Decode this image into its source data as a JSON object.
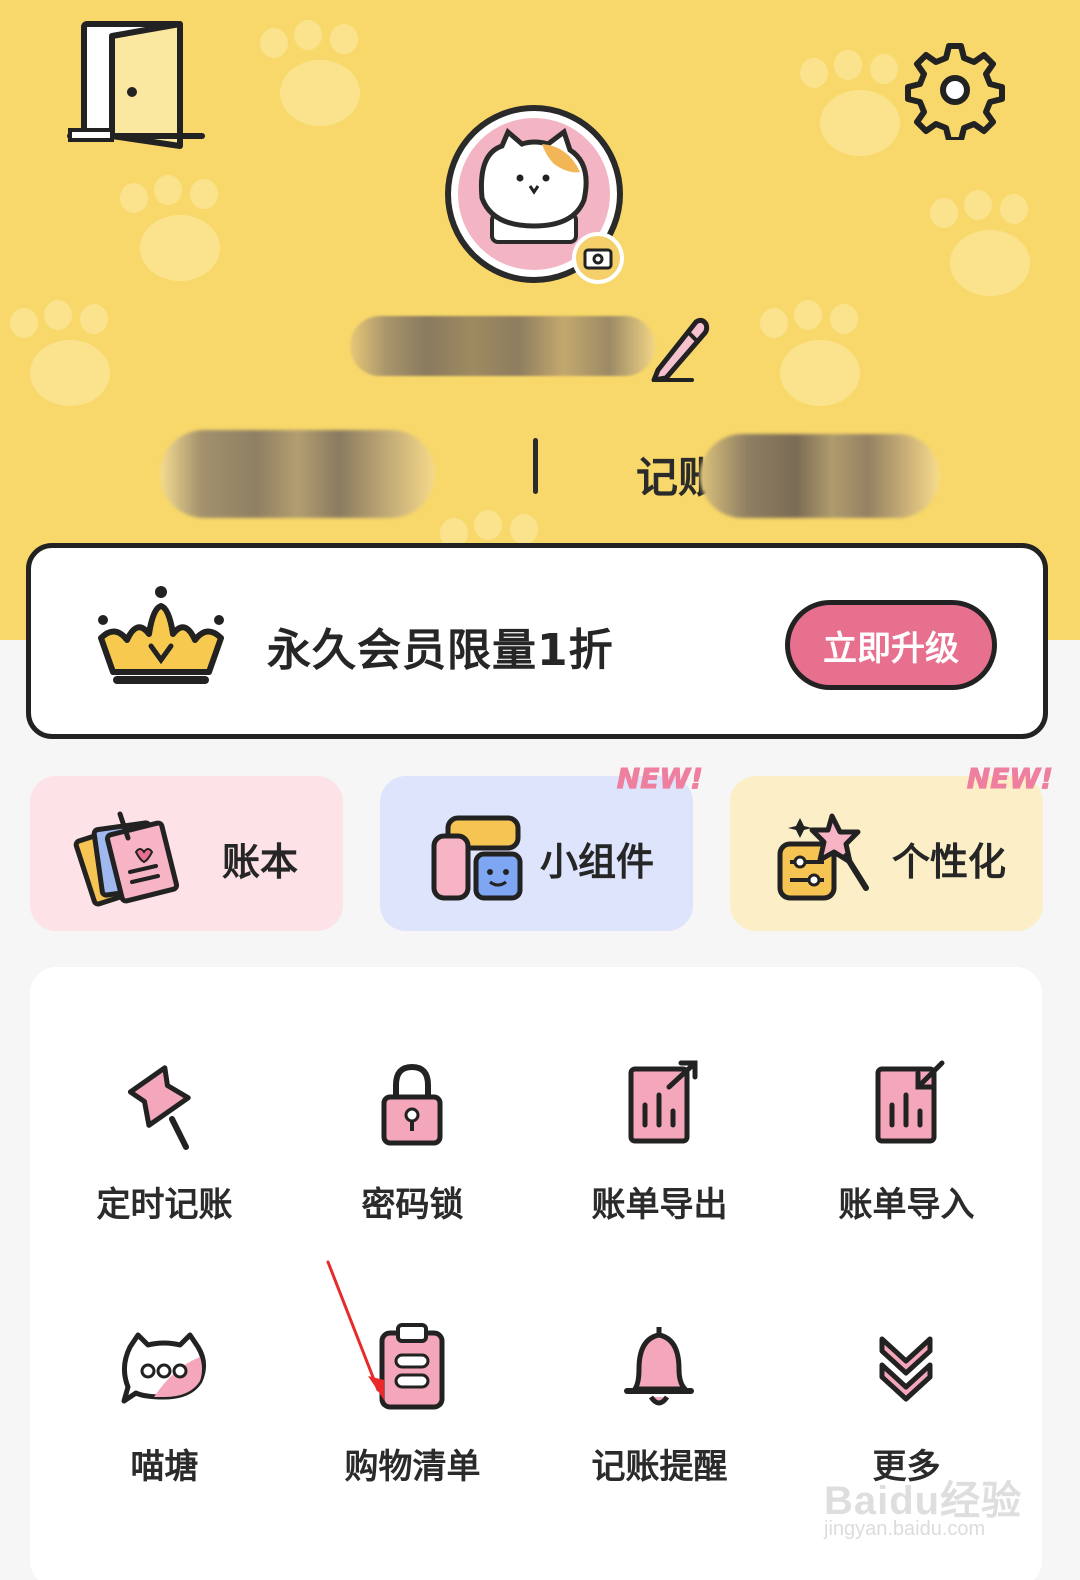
{
  "header": {
    "username": "",
    "stat_left": "",
    "stat_right_label": "记账",
    "stat_right_value": ""
  },
  "vip": {
    "promo_text": "永久会员限量1折",
    "upgrade_label": "立即升级"
  },
  "features": [
    {
      "label": "账本",
      "icon": "notebook-icon",
      "bg": "#fde3e8",
      "badge": ""
    },
    {
      "label": "小组件",
      "icon": "widget-icon",
      "bg": "#dde4fb",
      "badge": "NEW!"
    },
    {
      "label": "个性化",
      "icon": "magic-wand-icon",
      "bg": "#fcefc7",
      "badge": "NEW!"
    }
  ],
  "tools": [
    {
      "label": "定时记账",
      "icon": "pin-icon"
    },
    {
      "label": "密码锁",
      "icon": "lock-icon"
    },
    {
      "label": "账单导出",
      "icon": "export-icon"
    },
    {
      "label": "账单导入",
      "icon": "import-icon"
    },
    {
      "label": "喵塘",
      "icon": "chat-bubble-icon"
    },
    {
      "label": "购物清单",
      "icon": "clipboard-icon"
    },
    {
      "label": "记账提醒",
      "icon": "bell-icon"
    },
    {
      "label": "更多",
      "icon": "double-chevron-down-icon"
    }
  ],
  "watermark": {
    "brand": "Baidu经验",
    "url": "jingyan.baidu.com"
  },
  "colors": {
    "header_bg": "#f8d86a",
    "accent_pink": "#e8708f",
    "icon_pink": "#f4a7bb"
  }
}
